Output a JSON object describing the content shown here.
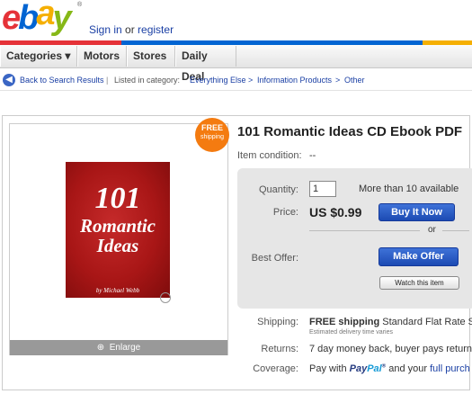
{
  "header": {
    "logo": {
      "e": "e",
      "b": "b",
      "a": "a",
      "y": "y",
      "tm": "®"
    },
    "signin": {
      "sign_in": "Sign in",
      "or": " or ",
      "register": "register"
    },
    "brand_colors": {
      "red": "#e53238",
      "blue": "#0064d2",
      "yellow": "#f5af02",
      "green": "#86b817"
    }
  },
  "nav": {
    "categories": "Categories ▾",
    "motors": "Motors",
    "stores": "Stores",
    "daily_deal": "Daily Deal"
  },
  "breadcrumbs": {
    "back_icon": "arrow-left-icon",
    "back": "Back to Search Results",
    "sep1": "|",
    "listed": "Listed in category:",
    "cat1": "Everything Else",
    "gt1": ">",
    "cat2": "Information Products",
    "gt2": ">",
    "cat3": "Other"
  },
  "item": {
    "badge_line1": "FREE",
    "badge_line2": "shipping",
    "cover_title_1": "101",
    "cover_title_2": "Romantic",
    "cover_title_3": "Ideas",
    "cover_author": "by Michael Webb",
    "enlarge_icon": "magnifier-icon",
    "enlarge": "Enlarge",
    "title": "101 Romantic Ideas CD Ebook PDF",
    "condition_label": "Item condition:",
    "condition_value": "--"
  },
  "buy": {
    "quantity_label": "Quantity:",
    "quantity_value": "1",
    "availability": "More than 10 available",
    "price_label": "Price:",
    "price": "US $0.99",
    "buy_now": "Buy It Now",
    "or": "or",
    "best_offer_label": "Best Offer:",
    "make_offer": "Make Offer",
    "watch": "Watch this item"
  },
  "details": {
    "shipping_label": "Shipping:",
    "shipping_free": "FREE shipping",
    "shipping_rest": " Standard Flat Rate Sh",
    "shipping_note": "Estimated delivery time varies",
    "returns_label": "Returns:",
    "returns_value": "7 day money back, buyer pays return",
    "coverage_label": "Coverage:",
    "coverage_pay": "Pay with ",
    "paypal_1": "Pay",
    "paypal_2": "Pal",
    "paypal_tm": "®",
    "coverage_and": " and your ",
    "coverage_link": "full purch"
  }
}
